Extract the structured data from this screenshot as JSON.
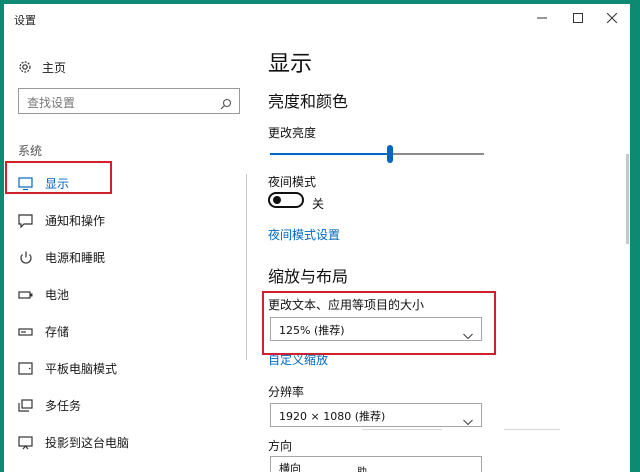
{
  "window": {
    "title": "设置",
    "controls": {
      "minimize": "minimize-icon",
      "maximize": "maximize-icon",
      "close": "close-icon"
    }
  },
  "sidebar": {
    "home_label": "主页",
    "home_icon": "gear-icon",
    "search_placeholder": "查找设置",
    "search_icon": "search-icon",
    "section_label": "系统",
    "items": [
      {
        "label": "显示",
        "icon": "monitor-icon",
        "active": true
      },
      {
        "label": "通知和操作",
        "icon": "message-icon"
      },
      {
        "label": "电源和睡眠",
        "icon": "power-icon"
      },
      {
        "label": "电池",
        "icon": "battery-icon"
      },
      {
        "label": "存储",
        "icon": "storage-icon"
      },
      {
        "label": "平板电脑模式",
        "icon": "tablet-icon"
      },
      {
        "label": "多任务",
        "icon": "multitask-icon"
      },
      {
        "label": "投影到这台电脑",
        "icon": "project-icon"
      }
    ]
  },
  "main": {
    "title": "显示",
    "brightness_section": "亮度和颜色",
    "brightness_label": "更改亮度",
    "brightness_value": 0.56,
    "night_mode_label": "夜间模式",
    "night_mode_state": "关",
    "night_mode_link": "夜间模式设置",
    "scale_section": "缩放与布局",
    "scale_label": "更改文本、应用等项目的大小",
    "scale_value": "125% (推荐)",
    "custom_scale_link": "自定义缩放",
    "resolution_label": "分辨率",
    "resolution_value": "1920 × 1080 (推荐)",
    "orientation_label": "方向",
    "orientation_value_partial": "横向",
    "bottom_partial": "助"
  },
  "colors": {
    "accent": "#0067c0",
    "highlight": "#d1202d",
    "background": "#0f8a72"
  }
}
